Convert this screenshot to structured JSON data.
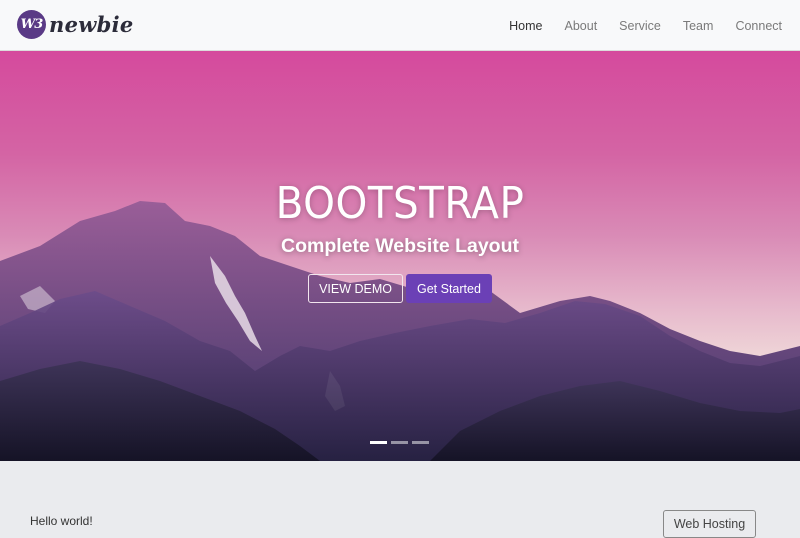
{
  "brand": {
    "badge_text": "W3",
    "name": "newbie",
    "badge_color": "#5a3a86"
  },
  "nav": {
    "items": [
      {
        "label": "Home",
        "active": true
      },
      {
        "label": "About",
        "active": false
      },
      {
        "label": "Service",
        "active": false
      },
      {
        "label": "Team",
        "active": false
      },
      {
        "label": "Connect",
        "active": false
      }
    ]
  },
  "hero": {
    "title": "BOOTSTRAP",
    "subtitle": "Complete Website Layout",
    "demo_button": "VIEW DEMO",
    "start_button": "Get Started",
    "start_button_color": "#6b40b6",
    "carousel": {
      "slides": 3,
      "active_index": 0
    }
  },
  "content": {
    "intro": "Hello world!",
    "hosting_button": "Web Hosting"
  }
}
